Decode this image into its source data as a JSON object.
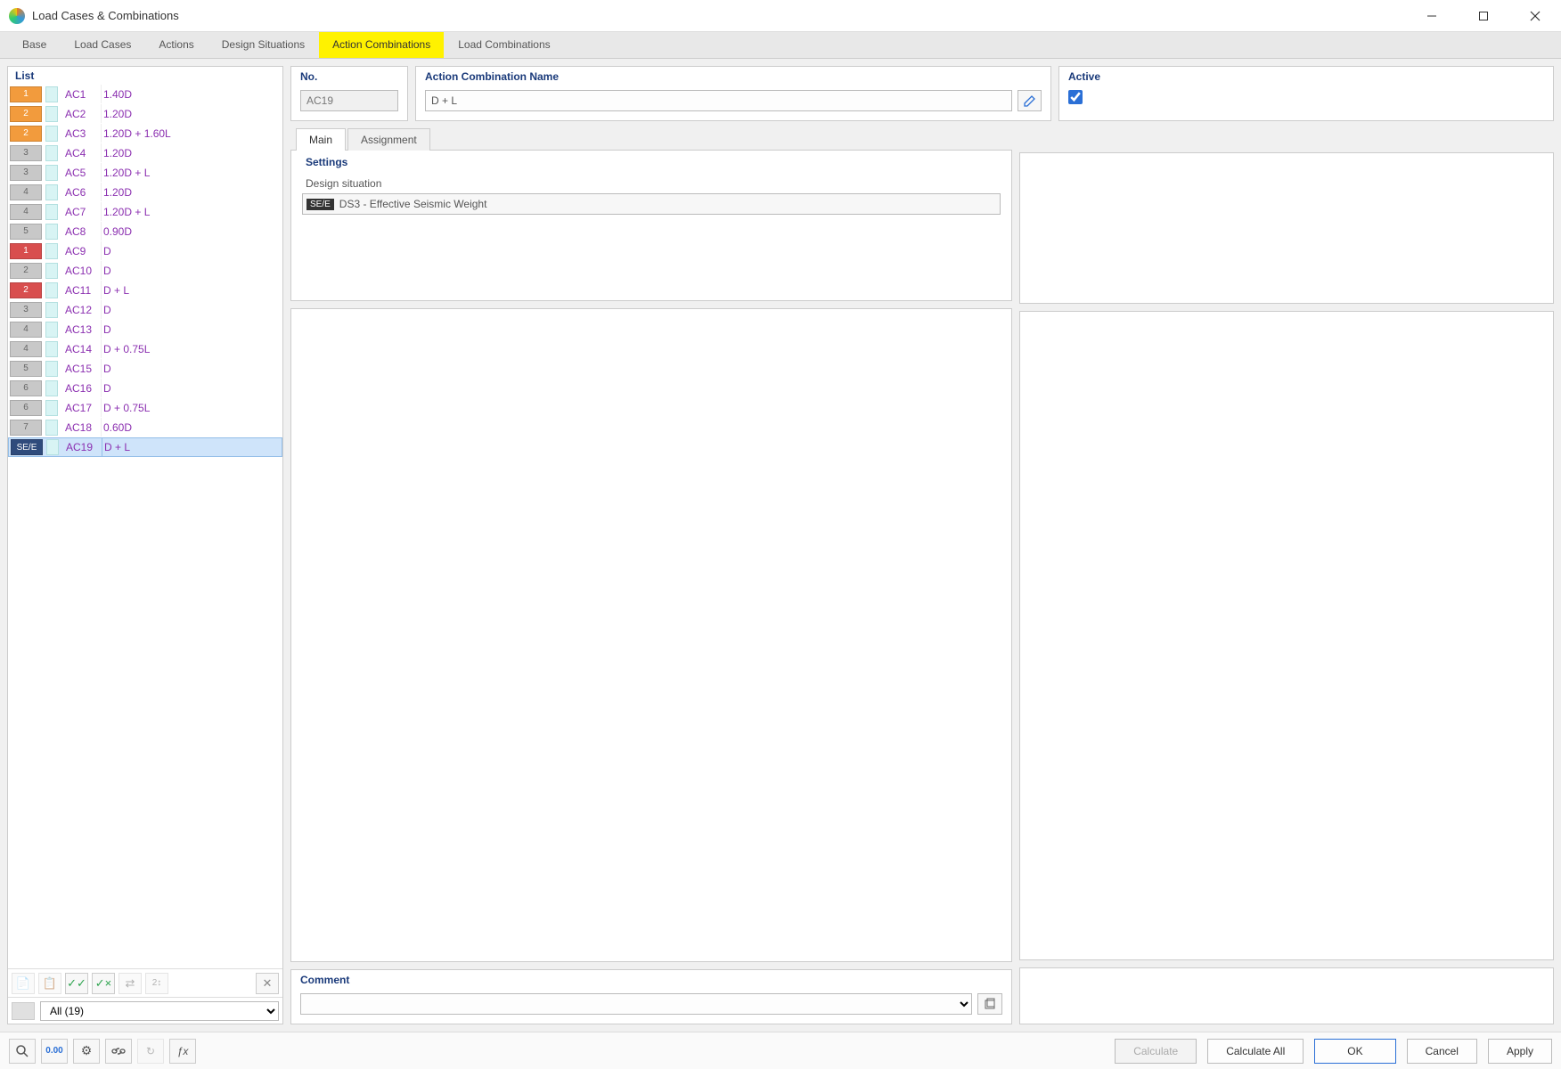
{
  "window": {
    "title": "Load Cases & Combinations"
  },
  "tabs": [
    {
      "label": "Base"
    },
    {
      "label": "Load Cases"
    },
    {
      "label": "Actions"
    },
    {
      "label": "Design Situations"
    },
    {
      "label": "Action Combinations",
      "active": true
    },
    {
      "label": "Load Combinations"
    }
  ],
  "list": {
    "header": "List",
    "rows": [
      {
        "badge": "1",
        "color": "#f29b3d",
        "ac": "AC1",
        "desc": "1.40D"
      },
      {
        "badge": "2",
        "color": "#f29b3d",
        "ac": "AC2",
        "desc": "1.20D"
      },
      {
        "badge": "2",
        "color": "#f29b3d",
        "ac": "AC3",
        "desc": "1.20D + 1.60L"
      },
      {
        "badge": "3",
        "color": "#c8c8c8",
        "ac": "AC4",
        "desc": "1.20D"
      },
      {
        "badge": "3",
        "color": "#c8c8c8",
        "ac": "AC5",
        "desc": "1.20D + L"
      },
      {
        "badge": "4",
        "color": "#c8c8c8",
        "ac": "AC6",
        "desc": "1.20D"
      },
      {
        "badge": "4",
        "color": "#c8c8c8",
        "ac": "AC7",
        "desc": "1.20D + L"
      },
      {
        "badge": "5",
        "color": "#c8c8c8",
        "ac": "AC8",
        "desc": "0.90D"
      },
      {
        "badge": "1",
        "color": "#d84e4e",
        "ac": "AC9",
        "desc": "D"
      },
      {
        "badge": "2",
        "color": "#c8c8c8",
        "ac": "AC10",
        "desc": "D"
      },
      {
        "badge": "2",
        "color": "#d84e4e",
        "ac": "AC11",
        "desc": "D + L"
      },
      {
        "badge": "3",
        "color": "#c8c8c8",
        "ac": "AC12",
        "desc": "D"
      },
      {
        "badge": "4",
        "color": "#c8c8c8",
        "ac": "AC13",
        "desc": "D"
      },
      {
        "badge": "4",
        "color": "#c8c8c8",
        "ac": "AC14",
        "desc": "D + 0.75L"
      },
      {
        "badge": "5",
        "color": "#c8c8c8",
        "ac": "AC15",
        "desc": "D"
      },
      {
        "badge": "6",
        "color": "#c8c8c8",
        "ac": "AC16",
        "desc": "D"
      },
      {
        "badge": "6",
        "color": "#c8c8c8",
        "ac": "AC17",
        "desc": "D + 0.75L"
      },
      {
        "badge": "7",
        "color": "#c8c8c8",
        "ac": "AC18",
        "desc": "0.60D"
      },
      {
        "badge": "SE/E",
        "color": "#2f4b7c",
        "ac": "AC19",
        "desc": "D + L",
        "selected": true
      }
    ],
    "filter": {
      "label": "All (19)"
    }
  },
  "details": {
    "no_label": "No.",
    "no_value": "AC19",
    "name_label": "Action Combination Name",
    "name_value": "D + L",
    "active_label": "Active",
    "active_checked": true,
    "subtabs": [
      {
        "label": "Main",
        "active": true
      },
      {
        "label": "Assignment"
      }
    ],
    "settings_label": "Settings",
    "dsit_label": "Design situation",
    "dsit_tag": "SE/E",
    "dsit_value": "DS3 - Effective Seismic Weight",
    "comment_label": "Comment"
  },
  "bottom": {
    "calc": "Calculate",
    "calc_all": "Calculate All",
    "ok": "OK",
    "cancel": "Cancel",
    "apply": "Apply"
  }
}
